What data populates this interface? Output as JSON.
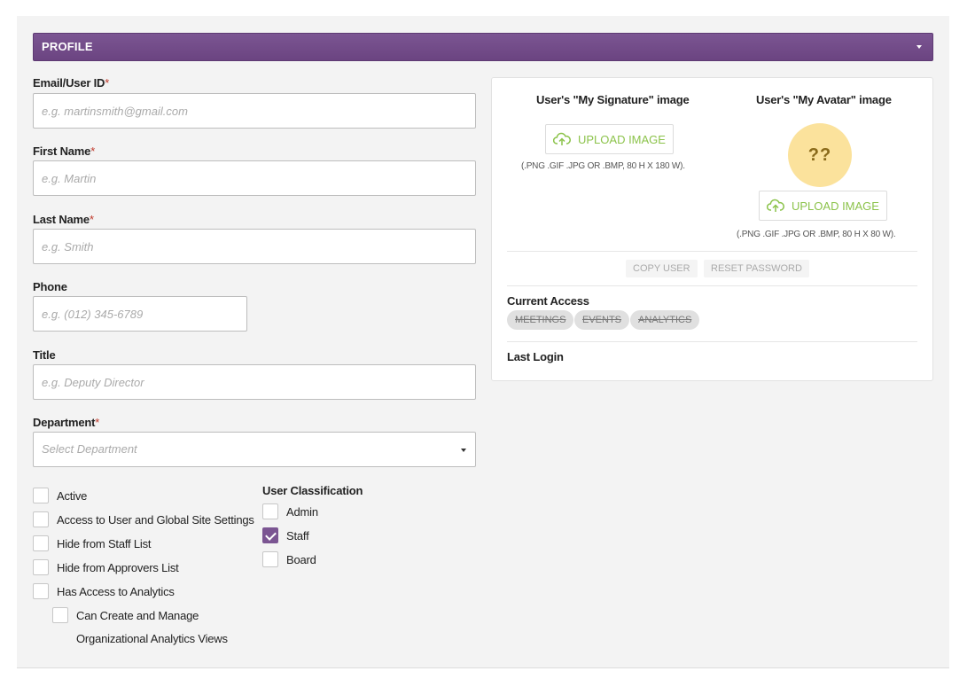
{
  "header": {
    "title": "PROFILE"
  },
  "form": {
    "email": {
      "label": "Email/User ID",
      "required": "*",
      "placeholder": "e.g. martinsmith@gmail.com"
    },
    "first_name": {
      "label": "First Name",
      "required": "*",
      "placeholder": "e.g. Martin"
    },
    "last_name": {
      "label": "Last Name",
      "required": "*",
      "placeholder": "e.g. Smith"
    },
    "phone": {
      "label": "Phone",
      "placeholder": "e.g. (012) 345-6789"
    },
    "title": {
      "label": "Title",
      "placeholder": "e.g. Deputy Director"
    },
    "department": {
      "label": "Department",
      "required": "*",
      "placeholder": "Select Department"
    }
  },
  "options": [
    {
      "label": "Active",
      "checked": false
    },
    {
      "label": "Access to User and Global Site Settings",
      "checked": false
    },
    {
      "label": "Hide from Staff List",
      "checked": false
    },
    {
      "label": "Hide from Approvers List",
      "checked": false
    },
    {
      "label": "Has Access to Analytics",
      "checked": false
    },
    {
      "label": "Can Create and Manage",
      "label2": "Organizational Analytics Views",
      "checked": false
    }
  ],
  "classification": {
    "title": "User Classification",
    "items": [
      {
        "label": "Admin",
        "checked": false
      },
      {
        "label": "Staff",
        "checked": true
      },
      {
        "label": "Board",
        "checked": false
      }
    ]
  },
  "signature": {
    "title": "User's \"My Signature\" image",
    "button": "UPLOAD IMAGE",
    "hint": "(.PNG .GIF .JPG OR .BMP, 80 H X 180 W)."
  },
  "avatar": {
    "title": "User's \"My Avatar\" image",
    "initials": "??",
    "button": "UPLOAD IMAGE",
    "hint": "(.PNG .GIF .JPG OR .BMP, 80 H X 80 W)."
  },
  "actions": {
    "copy_user": "COPY USER",
    "reset_password": "RESET PASSWORD"
  },
  "access": {
    "title": "Current Access",
    "items": [
      "MEETINGS",
      "EVENTS",
      "ANALYTICS"
    ]
  },
  "last_login": {
    "title": "Last Login"
  },
  "colors": {
    "header": "#6b4481",
    "accent": "#7b5592",
    "upload": "#8cc34b",
    "avatar_bg": "#fbe29c",
    "required": "#c0392b"
  },
  "icons": {
    "upload": "cloud-upload-icon",
    "header_caret": "caret-down-icon",
    "select_caret": "caret-down-icon"
  }
}
